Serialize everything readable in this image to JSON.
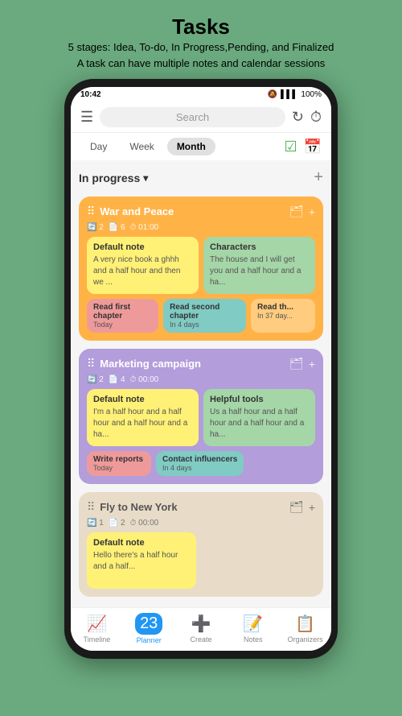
{
  "header": {
    "title": "Tasks",
    "subtitle1": "5 stages: Idea, To-do, In Progress,Pending, and Finalized",
    "subtitle2": "A task can have multiple notes and calendar sessions"
  },
  "statusBar": {
    "time": "10:42",
    "battery": "100%"
  },
  "toolbar": {
    "searchPlaceholder": "Search"
  },
  "viewTabs": {
    "tabs": [
      "Day",
      "Week",
      "Month"
    ],
    "activeTab": "Month"
  },
  "stage": {
    "label": "In progress",
    "addLabel": "+"
  },
  "tasks": [
    {
      "id": "war-peace",
      "title": "War and Peace",
      "meta": "2  6  01:00",
      "colorClass": "orange",
      "notes": [
        {
          "title": "Default note",
          "body": "A very nice book a ghhh and a half hour and then we ...",
          "colorClass": "yellow"
        },
        {
          "title": "Characters",
          "body": "The house and I will get you and a half hour and a ha...",
          "colorClass": "green"
        }
      ],
      "sessions": [
        {
          "title": "Read first chapter",
          "sub": "Today",
          "colorClass": "red"
        },
        {
          "title": "Read second chapter",
          "sub": "In 4 days",
          "colorClass": "teal"
        },
        {
          "title": "Read th...",
          "sub": "In 37 day...",
          "colorClass": "read"
        }
      ]
    },
    {
      "id": "marketing",
      "title": "Marketing campaign",
      "meta": "2  4  00:00",
      "colorClass": "purple",
      "notes": [
        {
          "title": "Default note",
          "body": "I'm a half hour and a half hour and a half hour and a ha...",
          "colorClass": "yellow"
        },
        {
          "title": "Helpful tools",
          "body": "Us a half hour and a half hour and a half hour and a ha...",
          "colorClass": "green"
        }
      ],
      "sessions": [
        {
          "title": "Write reports",
          "sub": "Today",
          "colorClass": "red"
        },
        {
          "title": "Contact influencers",
          "sub": "In 4 days",
          "colorClass": "teal"
        }
      ]
    },
    {
      "id": "fly-newyork",
      "title": "Fly to New York",
      "meta": "1  2  00:00",
      "colorClass": "beige",
      "notes": [
        {
          "title": "Default note",
          "body": "Hello there's a half hour and a half...",
          "colorClass": "yellow"
        }
      ],
      "sessions": []
    }
  ],
  "bottomNav": [
    {
      "id": "timeline",
      "icon": "📈",
      "label": "Timeline",
      "active": false
    },
    {
      "id": "planner",
      "icon": "📅",
      "label": "Planner",
      "active": true
    },
    {
      "id": "create",
      "icon": "➕",
      "label": "Create",
      "active": false
    },
    {
      "id": "notes",
      "icon": "📝",
      "label": "Notes",
      "active": false
    },
    {
      "id": "organizers",
      "icon": "📋",
      "label": "Organizers",
      "active": false
    }
  ]
}
